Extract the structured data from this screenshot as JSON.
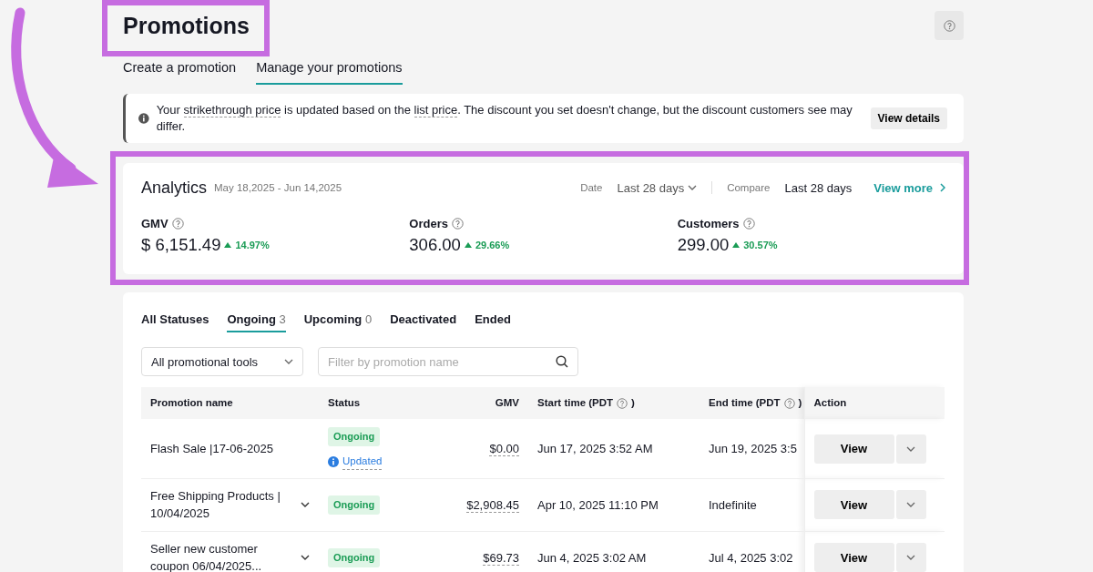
{
  "title": "Promotions",
  "header_tabs": [
    {
      "label": "Create a promotion",
      "selected": false
    },
    {
      "label": "Manage your promotions",
      "selected": true
    }
  ],
  "notice": {
    "parts": [
      {
        "text": "Your ",
        "term": false
      },
      {
        "text": "strikethrough price",
        "term": true
      },
      {
        "text": " is updated based on the ",
        "term": false
      },
      {
        "text": "list price",
        "term": true
      },
      {
        "text": ". The discount you set doesn't change, but the discount customers see may differ.",
        "term": false
      }
    ],
    "button": "View details"
  },
  "analytics": {
    "title": "Analytics",
    "date_range": "May 18,2025 - Jun 14,2025",
    "date_label": "Date",
    "date_value": "Last 28 days",
    "compare_label": "Compare",
    "compare_value": "Last 28 days",
    "view_more": "View more",
    "metrics": [
      {
        "label": "GMV",
        "value": "$ 6,151.49",
        "change": "14.97%",
        "rising": true
      },
      {
        "label": "Orders",
        "value": "306.00",
        "change": "29.66%",
        "rising": true
      },
      {
        "label": "Customers",
        "value": "299.00",
        "change": "30.57%",
        "rising": true
      }
    ]
  },
  "status_tabs": [
    {
      "label": "All Statuses",
      "selected": false
    },
    {
      "label": "Ongoing",
      "count": "3",
      "selected": true
    },
    {
      "label": "Upcoming",
      "count": "0",
      "selected": false
    },
    {
      "label": "Deactivated",
      "selected": false
    },
    {
      "label": "Ended",
      "selected": false
    }
  ],
  "tool_select": "All promotional tools",
  "filter": {
    "placeholder": "Filter by promotion name"
  },
  "columns": [
    {
      "label": "Promotion name",
      "help": false
    },
    {
      "label": "Status",
      "help": false
    },
    {
      "label": "GMV",
      "help": false
    },
    {
      "label": "Start time (PDT",
      "help": true,
      "label_end": ")"
    },
    {
      "label": "End time (PDT",
      "help": true,
      "label_end": ")"
    },
    {
      "label": "Action",
      "help": false
    }
  ],
  "rows": [
    {
      "name": "Flash Sale |17-06-2025",
      "expandable": false,
      "status": "Ongoing",
      "note": "Updated",
      "gmv": "$0.00",
      "start": "Jun 17, 2025 3:52 AM",
      "end": "Jun 19, 2025 3:5",
      "action": "View"
    },
    {
      "name": "Free Shipping Products | 10/04/2025",
      "expandable": true,
      "status": "Ongoing",
      "gmv": "$2,908.45",
      "start": "Apr 10, 2025 11:10 PM",
      "end": "Indefinite",
      "action": "View"
    },
    {
      "name": "Seller new customer coupon 06/04/2025...",
      "expandable": true,
      "status": "Ongoing",
      "gmv": "$69.73",
      "start": "Jun 4, 2025 3:02 AM",
      "end": "Jul 4, 2025 3:02",
      "action": "View"
    }
  ]
}
